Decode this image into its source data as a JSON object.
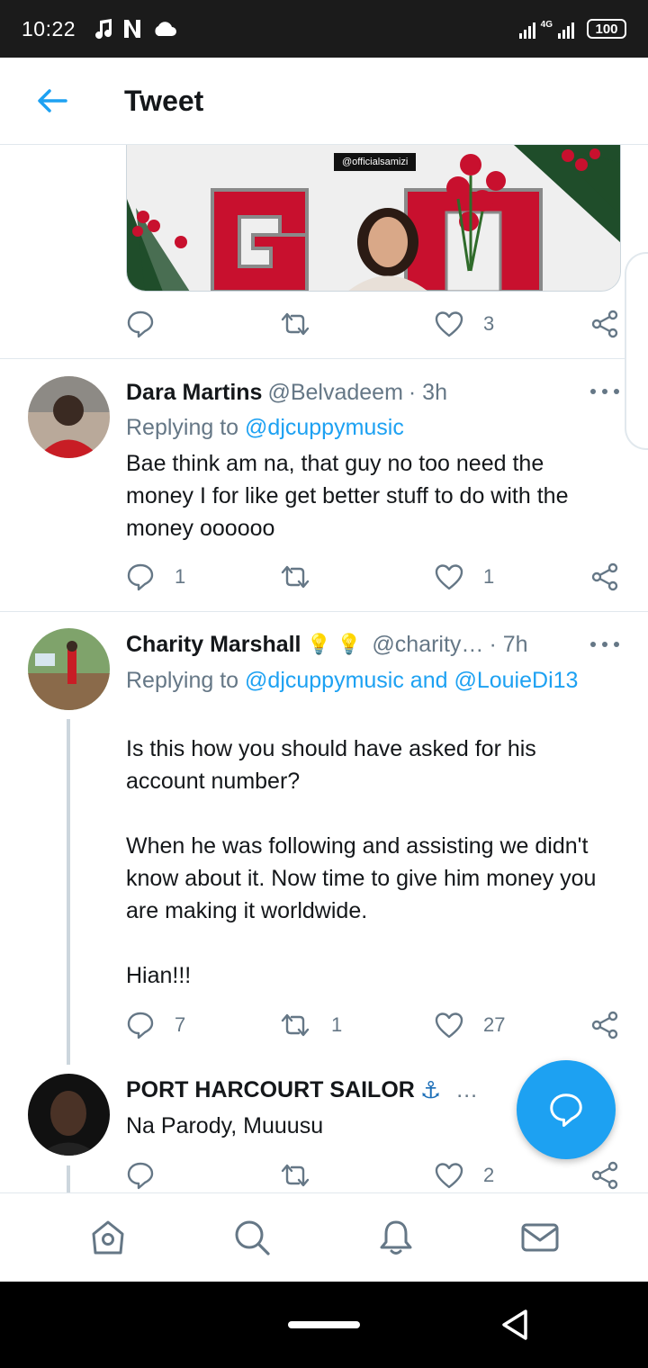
{
  "status_bar": {
    "time": "10:22",
    "network": "4G",
    "battery": "100"
  },
  "header": {
    "title": "Tweet"
  },
  "top_tweet": {
    "media_tag": "@officialsamizi",
    "like_count": "3"
  },
  "replies": [
    {
      "name": "Dara Martins",
      "handle": "@Belvadeem",
      "time": "· 3h",
      "replying_prefix": "Replying to ",
      "replying_mentions": "@djcuppymusic",
      "text": "Bae think am na, that guy no too need the money I for like get better stuff to do with the money oooooo",
      "reply_count": "1",
      "retweet_count": "",
      "like_count": "1"
    },
    {
      "name": "Charity Marshall",
      "emoji": "💡 💡",
      "handle": "@charity…",
      "time": "· 7h",
      "replying_prefix": "Replying to ",
      "replying_mentions": "@djcuppymusic and @LouieDi13",
      "text": "Is this how you should have asked for his account number?\n\nWhen he was following and assisting we didn't know about it. Now time to give him money you are making it worldwide.\n\nHian!!!",
      "reply_count": "7",
      "retweet_count": "1",
      "like_count": "27"
    },
    {
      "name": "PORT HARCOURT SAILOR",
      "emoji": "⚓",
      "handle": "…",
      "text": "Na Parody, Muuusu",
      "reply_count": "",
      "retweet_count": "",
      "like_count": "2"
    }
  ],
  "colors": {
    "accent": "#1da1f2",
    "muted": "#657786",
    "text": "#14171a",
    "divider": "#e1e8ed"
  },
  "bottom_nav": [
    "home-icon",
    "search-icon",
    "bell-icon",
    "mail-icon"
  ]
}
